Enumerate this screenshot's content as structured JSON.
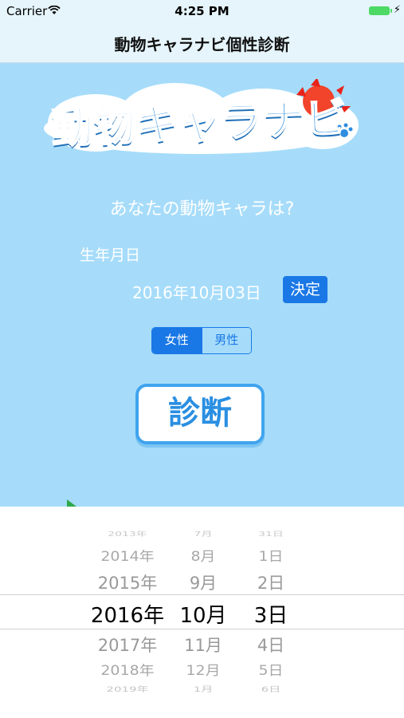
{
  "status_bar": {
    "carrier": "Carrier",
    "time": "4:25 PM"
  },
  "nav": {
    "title": "動物キャラナビ個性診断"
  },
  "logo": {
    "text": "動物キャラナビ"
  },
  "main": {
    "question": "あなたの動物キャラは?",
    "birthdate_label": "生年月日",
    "birthdate_value": "2016年10月03日",
    "decide_label": "決定",
    "gender": {
      "female": "女性",
      "male": "男性",
      "selected": "女性"
    },
    "diagnose_label": "診断"
  },
  "picker": {
    "years": [
      "2013年",
      "2014年",
      "2015年",
      "2016年",
      "2017年",
      "2018年",
      "2019年"
    ],
    "months": [
      "7月",
      "8月",
      "9月",
      "10月",
      "11月",
      "12月",
      "1月"
    ],
    "days": [
      "31日",
      "1日",
      "2日",
      "3日",
      "4日",
      "5日",
      "6日"
    ],
    "selected": {
      "year": "2016年",
      "month": "10月",
      "day": "3日"
    }
  },
  "colors": {
    "background": "#a6dcfa",
    "accent": "#1a78e6",
    "nav_background": "#e5f5fb",
    "battery": "#4cd964"
  }
}
